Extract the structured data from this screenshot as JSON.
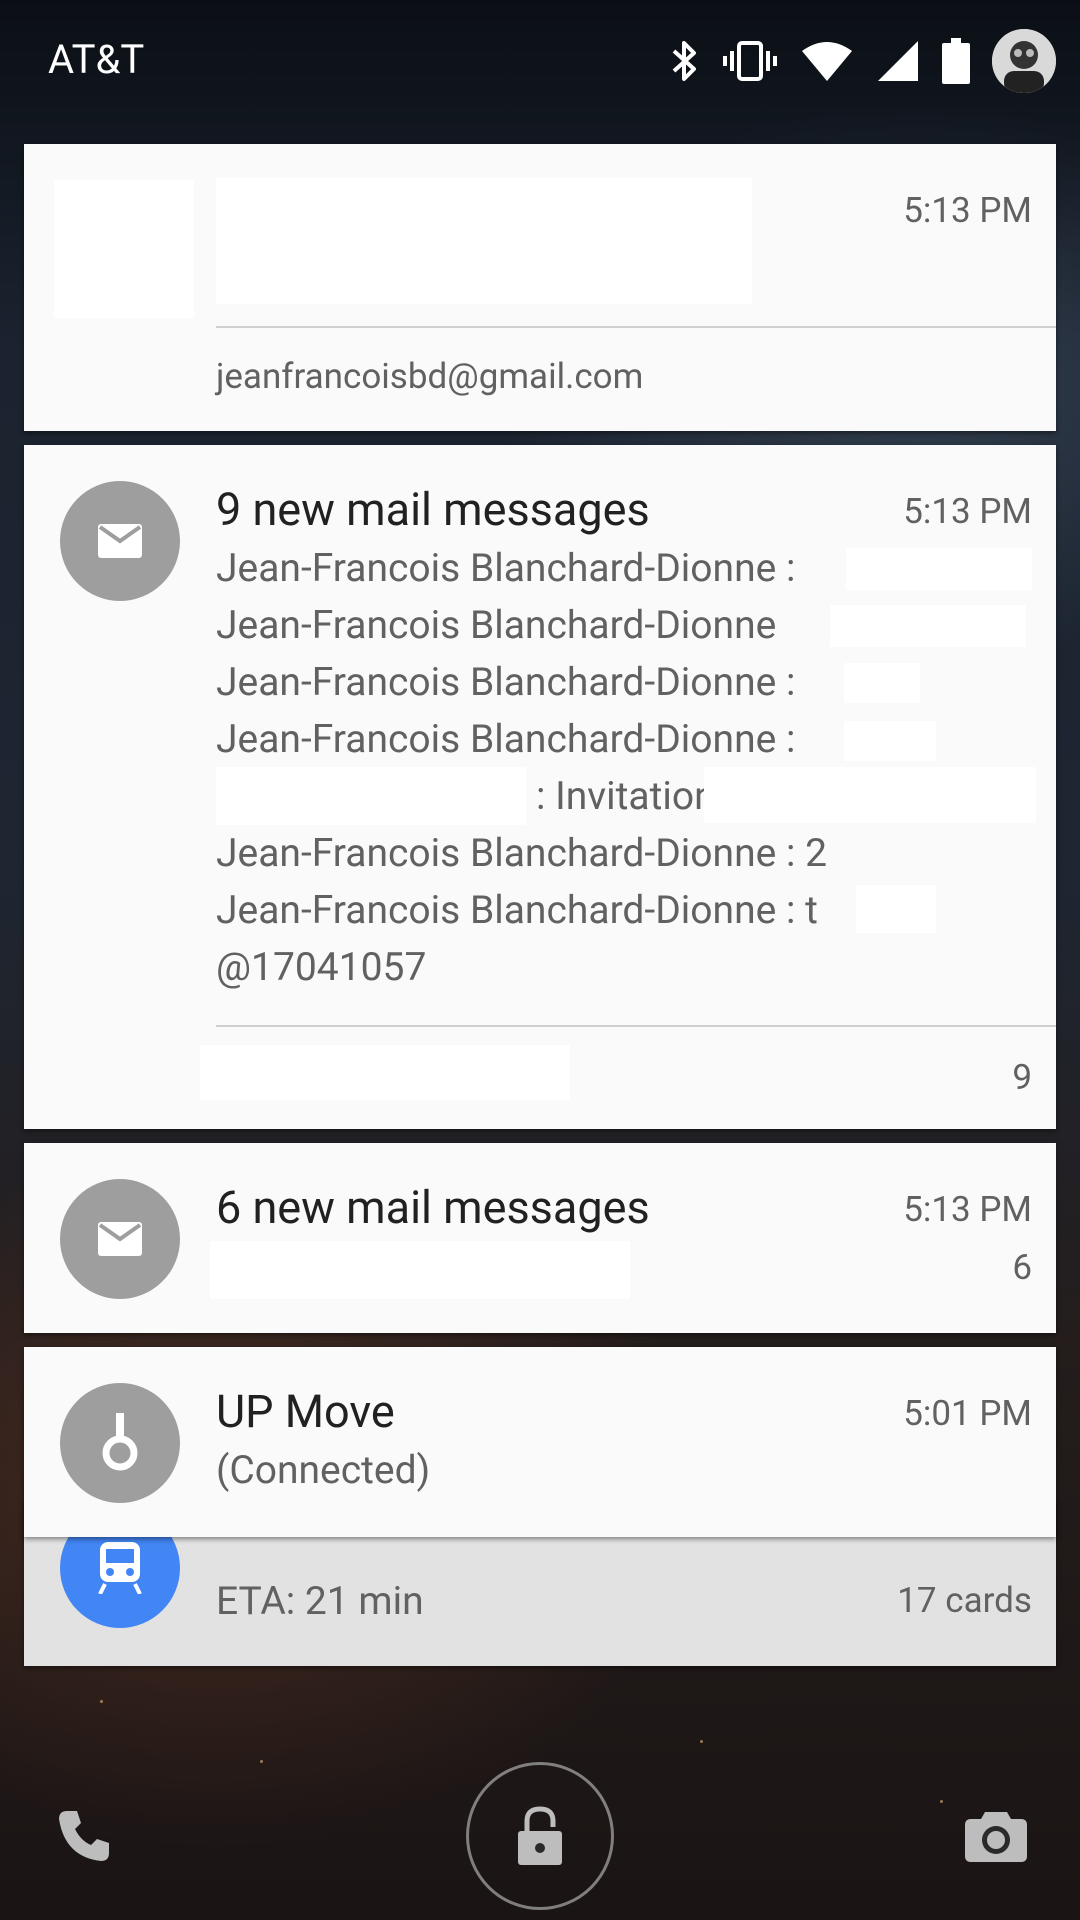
{
  "status_bar": {
    "carrier": "AT&T",
    "icons": [
      "bluetooth-icon",
      "vibrate-icon",
      "wifi-icon",
      "cell-signal-icon",
      "battery-icon",
      "avatar"
    ]
  },
  "notifications": [
    {
      "account": "jeanfrancoisbd@gmail.com",
      "time": "5:13 PM"
    },
    {
      "title": "9 new mail messages",
      "time": "5:13 PM",
      "lines": [
        "Jean-Francois Blanchard-Dionne : ",
        "Jean-Francois Blanchard-Dionne",
        "Jean-Francois Blanchard-Dionne : ",
        "Jean-Francois Blanchard-Dionne : ",
        ": Invitation",
        "Jean-Francois Blanchard-Dionne : 2",
        "Jean-Francois Blanchard-Dionne : t",
        "@17041057"
      ],
      "count": "9",
      "icon": "mail-icon"
    },
    {
      "title": "6 new mail messages",
      "time": "5:13 PM",
      "count": "6",
      "icon": "mail-icon"
    },
    {
      "title": "UP Move",
      "subtitle": "(Connected)",
      "time": "5:01 PM",
      "icon": "band-icon"
    },
    {
      "text": "ETA: 21 min",
      "cards": "17 cards",
      "icon": "train-icon",
      "icon_color": "#4285f4"
    }
  ],
  "lockscreen": {
    "left": "phone-icon",
    "center": "lock-icon",
    "right": "camera-icon"
  }
}
